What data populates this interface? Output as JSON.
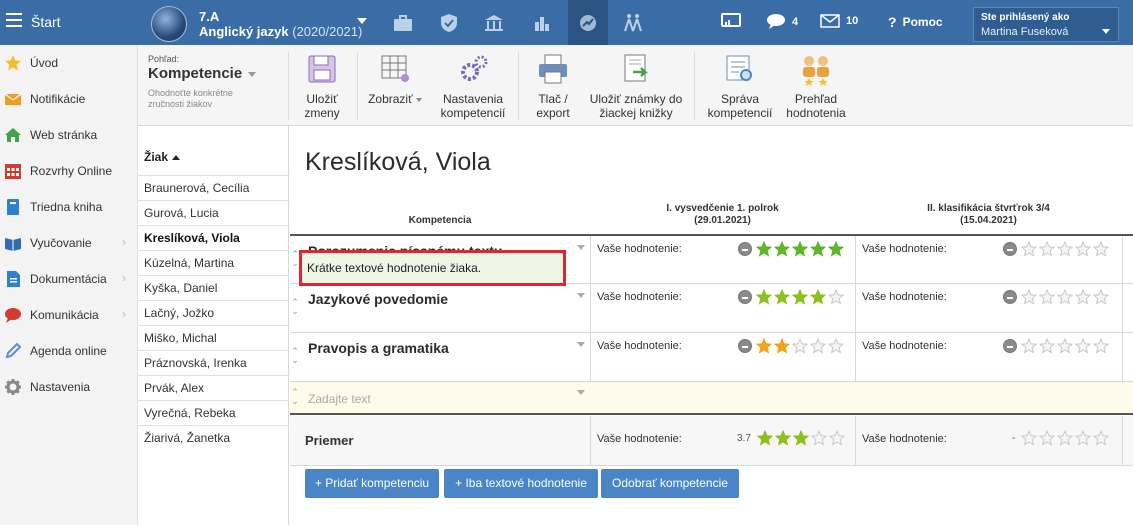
{
  "topbar": {
    "start_label": "Štart",
    "class_name": "7.A",
    "subject": "Anglický jazyk",
    "school_year": "(2020/2021)",
    "messages_count": "4",
    "mail_count": "10",
    "help_label": "Pomoc",
    "user_caption": "Ste prihlásený ako",
    "user_name": "Martina Fuseková",
    "accent": "#3a6da6"
  },
  "sidebar": {
    "items": [
      {
        "label": "Úvod",
        "icon": "star-icon"
      },
      {
        "label": "Notifikácie",
        "icon": "envelope-icon"
      },
      {
        "label": "Web stránka",
        "icon": "home-icon"
      },
      {
        "label": "Rozvrhy Online",
        "icon": "calendar-icon"
      },
      {
        "label": "Triedna kniha",
        "icon": "book-icon"
      },
      {
        "label": "Vyučovanie",
        "icon": "open-book-icon"
      },
      {
        "label": "Dokumentácia",
        "icon": "document-icon"
      },
      {
        "label": "Komunikácia",
        "icon": "chat-icon"
      },
      {
        "label": "Agenda online",
        "icon": "pen-icon"
      },
      {
        "label": "Nastavenia",
        "icon": "gear-icon"
      }
    ]
  },
  "ribbon": {
    "view_small": "Pohľad:",
    "view_title": "Kompetencie",
    "view_hint": "Ohodnoťte konkrétne zručnosti žiakov",
    "buttons": [
      {
        "label1": "Uložiť",
        "label2": "zmeny"
      },
      {
        "label1": "Zobraziť",
        "label2": ""
      },
      {
        "label1": "Nastavenia",
        "label2": "kompetencií"
      },
      {
        "label1": "Tlač /",
        "label2": "export"
      },
      {
        "label1": "Uložiť známky do",
        "label2": "žiackej knižky"
      },
      {
        "label1": "Správa",
        "label2": "kompetencií"
      },
      {
        "label1": "Prehľad",
        "label2": "hodnotenia"
      }
    ]
  },
  "students": {
    "header": "Žiak",
    "list": [
      "Braunerová, Cecília",
      "Gurová, Lucia",
      "Kreslíková, Viola",
      "Kúzelná, Martina",
      "Kyška, Daniel",
      "Lačný, Jožko",
      "Miško, Michal",
      "Práznovská, Irenka",
      "Prvák, Alex",
      "Vyrečná, Rebeka",
      "Žiarivá, Žanetka"
    ],
    "selected": "Kreslíková, Viola"
  },
  "main": {
    "student_title": "Kreslíková, Viola",
    "col_kompetencia": "Kompetencia",
    "col1_title": "I. vysvedčenie 1. polrok",
    "col1_date": "(29.01.2021)",
    "col2_title": "II. klasifikácia štvrťrok 3/4",
    "col2_date": "(15.04.2021)",
    "eval_label": "Vaše hodnotenie:",
    "rows": [
      {
        "name": "Porozumenie písanému textu",
        "rating1": 5,
        "rating2": 0
      },
      {
        "name": "Jazykové povedomie",
        "rating1": 4,
        "rating2": 0
      },
      {
        "name": "Pravopis a gramatika",
        "rating1": 2,
        "rating2": 0
      }
    ],
    "text_placeholder": "Zadajte text",
    "text_eval": "Krátke textové hodnotenie žiaka.",
    "avg_label": "Priemer",
    "avg1_value": "3.7",
    "avg1_stars": 3,
    "avg2_value": "-",
    "avg2_stars": 0,
    "buttons": {
      "add": "+ Pridať kompetenciu",
      "text_only": "+ Iba textové hodnotenie",
      "remove": "Odobrať kompetencie"
    }
  },
  "colors": {
    "star_green": "#5cb82a",
    "star_orange": "#f3a21b",
    "star_lime": "#8cc21c",
    "highlight_border": "#e3262e"
  }
}
